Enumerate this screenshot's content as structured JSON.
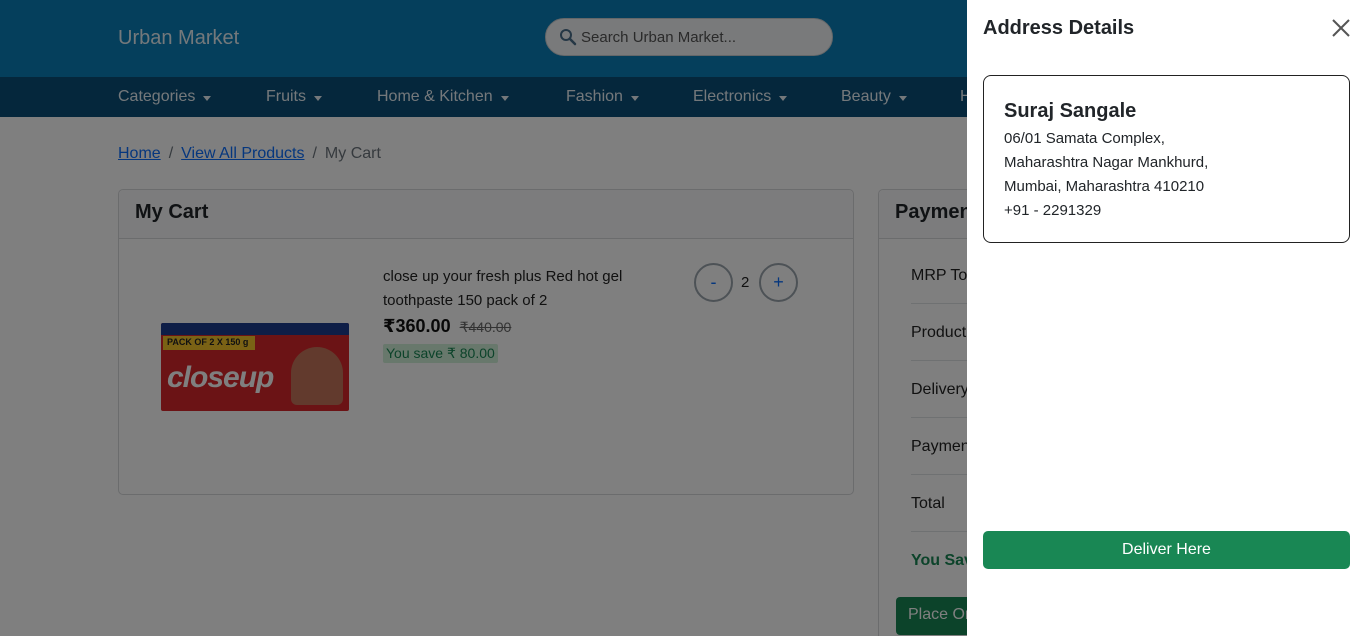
{
  "header": {
    "brand": "Urban Market",
    "search_placeholder": "Search Urban Market..."
  },
  "nav": {
    "items": [
      "Categories",
      "Fruits",
      "Home & Kitchen",
      "Fashion",
      "Electronics",
      "Beauty",
      "H"
    ]
  },
  "breadcrumb": {
    "home": "Home",
    "all_products": "View All Products",
    "current": "My Cart",
    "separator": "/"
  },
  "cart": {
    "title": "My Cart",
    "item": {
      "name": "close up your fresh plus Red hot gel toothpaste 150 pack of 2",
      "price": "₹360.00",
      "mrp": "₹440.00",
      "savings": "You save ₹ 80.00",
      "quantity": "2",
      "minus": "-",
      "plus": "+",
      "image_pack_text": "PACK OF 2 X 150 g",
      "image_logo": "closeup"
    }
  },
  "payment": {
    "title": "Paymen",
    "rows": [
      "MRP Tot",
      "Product",
      "Delivery",
      "Paymen",
      "Total"
    ],
    "savings_label": "You Sav",
    "place_order": "Place Or"
  },
  "panel": {
    "title": "Address Details",
    "address": {
      "name": "Suraj Sangale",
      "line1": "06/01 Samata Complex,",
      "line2": "Maharashtra Nagar Mankhurd,",
      "line3": "Mumbai, Maharashtra 410210",
      "phone": "+91 - 2291329"
    },
    "deliver_button": "Deliver Here"
  },
  "colors": {
    "header_bg": "#0a7fb8",
    "nav_bg": "#0b4e78",
    "success": "#198754",
    "link": "#0d6efd"
  }
}
